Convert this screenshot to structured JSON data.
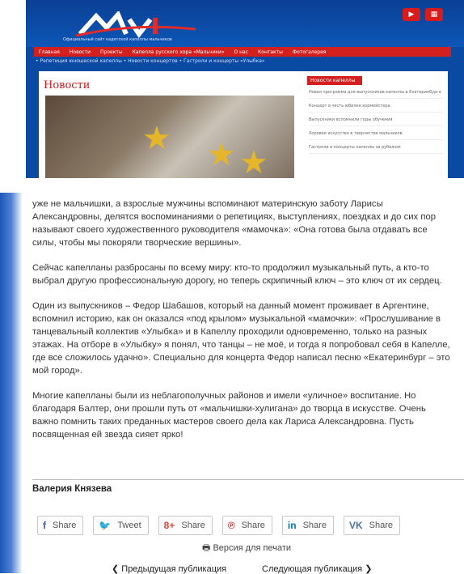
{
  "site": {
    "tagline": "Официальный сайт кадетской капеллы мальчиков",
    "nav": [
      "Главная",
      "Новости",
      "Проекты",
      "Капелла русского хора «Мальчики»",
      "О нас",
      "Контакты",
      "Фотогалерея"
    ],
    "ticker": "• Репетиция юношеской капеллы • Новости концертов • Гастроли и концерты «Улыбка»",
    "news_title": "Новости",
    "side_header": "Новости капеллы",
    "side_items": [
      "Новая программа для выпускников капеллы в Екатеринбурге",
      "Концерт в честь юбилея хормейстера",
      "Выпускники вспомнили годы обучения",
      "Хоровое искусство в творчестве мальчиков",
      "Гастроли и концерты капеллы за рубежом"
    ]
  },
  "article": {
    "paragraphs": [
      "уже не мальчишки, а взрослые мужчины вспоминают материнскую заботу Ларисы Александровны, делятся воспоминаниями о репетициях, выступлениях, поездках и до сих пор называют своего художественного руководителя «мамочка»: «Она готова была отдавать все силы, чтобы мы покоряли творческие вершины».",
      "Сейчас капелланы разбросаны по всему миру: кто-то продолжил музыкальный путь, а кто-то выбрал другую профессиональную дорогу, но теперь скрипичный ключ – это ключ от их сердец.",
      "Один из выпускников – Федор Шабашов, который на данный момент проживает в Аргентине, вспомнил историю, как он оказался «под крылом» музыкальной «мамочки»: «Прослушивание в танцевальный коллектив «Улыбка» и в Капеллу проходили одновременно, только на разных этажах. На отборе в «Улыбку» я понял, что танцы – не моё, и тогда я попробовал себя в Капелле, где все сложилось удачно». Специально для концерта Федор написал песню «Екатеринбург – это мой город».",
      "Многие капелланы были из неблагополучных районов и имели «уличное» воспитание. Но благодаря Балтер, они прошли путь от «мальчишки-хулигана» до творца в искусстве. Очень важно помнить таких преданных мастеров своего дела как Лариса Александровна. Пусть посвященная ей звезда сияет ярко!"
    ],
    "author": "Валерия Князева"
  },
  "share": {
    "buttons": [
      {
        "icon": "f",
        "label": "Share",
        "color": "#3b5998"
      },
      {
        "icon": "🐦",
        "label": "Tweet",
        "color": "#1da1f2"
      },
      {
        "icon": "8+",
        "label": "Share",
        "color": "#dd4b39"
      },
      {
        "icon": "℗",
        "label": "Share",
        "color": "#cb2027"
      },
      {
        "icon": "in",
        "label": "Share",
        "color": "#0077b5"
      },
      {
        "icon": "VK",
        "label": "Share",
        "color": "#4c75a3"
      }
    ],
    "print_label": "Версия для печати"
  },
  "pager": {
    "prev_label": "Предыдущая публикация",
    "next_label": "Следующая публикация"
  },
  "colors": {
    "brand_blue": "#0b4aa3",
    "brand_red": "#d41f1f"
  }
}
